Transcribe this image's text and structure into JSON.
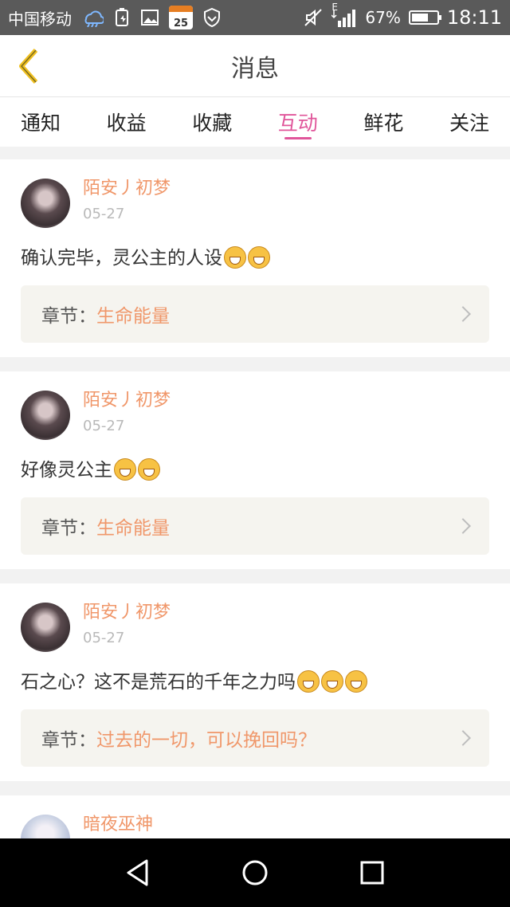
{
  "status_bar": {
    "carrier": "中国移动",
    "calendar_day": "25",
    "network_type": "E",
    "battery_percent": "67%",
    "battery_level": 0.67,
    "time": "18:11"
  },
  "header": {
    "title": "消息"
  },
  "tabs": [
    {
      "label": "通知",
      "active": false
    },
    {
      "label": "收益",
      "active": false
    },
    {
      "label": "收藏",
      "active": false
    },
    {
      "label": "互动",
      "active": true
    },
    {
      "label": "鲜花",
      "active": false
    },
    {
      "label": "关注",
      "active": false
    }
  ],
  "messages": [
    {
      "user": "陌安丿初梦",
      "date": "05-27",
      "text": "确认完毕，灵公主的人设",
      "emoji_count": 2,
      "chapter_label": "章节：",
      "chapter_title": "生命能量"
    },
    {
      "user": "陌安丿初梦",
      "date": "05-27",
      "text": "好像灵公主",
      "emoji_count": 2,
      "chapter_label": "章节：",
      "chapter_title": "生命能量"
    },
    {
      "user": "陌安丿初梦",
      "date": "05-27",
      "text": "石之心？这不是荒石的千年之力吗",
      "emoji_count": 3,
      "chapter_label": "章节：",
      "chapter_title": "过去的一切，可以挽回吗？"
    },
    {
      "user": "暗夜巫神"
    }
  ],
  "colors": {
    "accent_pink": "#e0559a",
    "username_orange": "#f0976a",
    "back_arrow": "#f0c020"
  },
  "icons": {
    "back": "back-arrow-icon",
    "nav_back": "triangle-back-icon",
    "nav_home": "circle-home-icon",
    "nav_recent": "square-recent-icon"
  }
}
